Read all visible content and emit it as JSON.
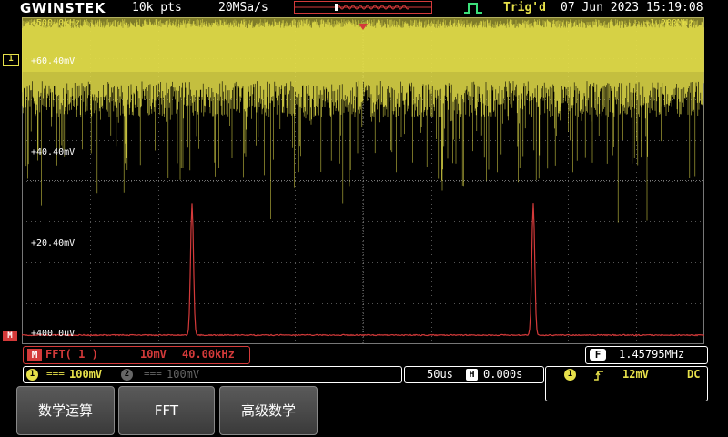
{
  "header": {
    "brand": "GWINSTEK",
    "record_length": "10k pts",
    "sample_rate": "20MSa/s",
    "trigger_status": "Trig'd",
    "datetime": "07 Jun 2023 15:19:08"
  },
  "screen": {
    "freq_start": "+500.0kHz",
    "freq_end": "+1.200MHz",
    "y_labels": [
      "+60.40mV",
      "+40.40mV",
      "+20.40mV",
      "+400.0uV"
    ]
  },
  "markers": {
    "ch1": "1",
    "math": "M"
  },
  "math": {
    "badge": "M",
    "function": "FFT( 1 )",
    "scale": "10mV",
    "span": "40.00kHz"
  },
  "freq_counter": {
    "badge": "F",
    "value": "1.45795MHz"
  },
  "channels": {
    "ch1": {
      "badge": "1",
      "coupling": "===",
      "scale": "100mV"
    },
    "ch2": {
      "badge": "2",
      "coupling": "===",
      "scale": "100mV"
    }
  },
  "timebase": {
    "scale": "50us",
    "h_icon": "H",
    "position": "0.000s"
  },
  "trigger": {
    "channel": "1",
    "level": "12mV",
    "coupling": "DC"
  },
  "softkeys": [
    "数学运算",
    "FFT",
    "高级数学"
  ],
  "colors": {
    "ch1": "#e6e04a",
    "math": "#d43a3a",
    "grid": "#555555",
    "background": "#000000"
  },
  "icons": {
    "trigger_edge": "rising-edge-icon",
    "trigger_pulse": "pulse-icon"
  }
}
